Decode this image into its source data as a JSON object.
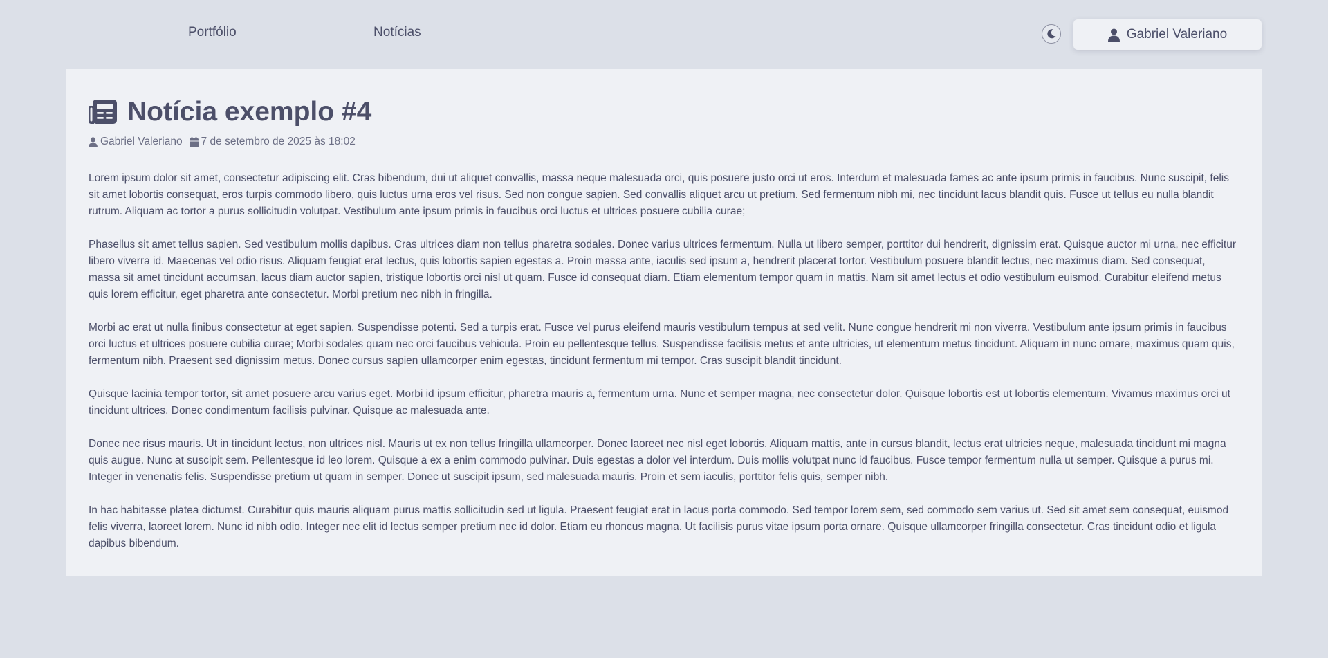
{
  "nav": {
    "portfolio_label": "Portfólio",
    "news_label": "Notícias"
  },
  "header": {
    "theme_toggle_icon": "moon-icon",
    "user_icon": "user-icon",
    "user_name": "Gabriel Valeriano"
  },
  "article": {
    "title_icon": "newspaper-icon",
    "title": "Notícia exemplo #4",
    "author_icon": "user-icon",
    "author": "Gabriel Valeriano",
    "date_icon": "calendar-icon",
    "date": "7 de setembro de 2025 às 18:02",
    "paragraphs": [
      " Lorem ipsum dolor sit amet, consectetur adipiscing elit. Cras bibendum, dui ut aliquet convallis, massa neque malesuada orci, quis posuere justo orci ut eros. Interdum et malesuada fames ac ante ipsum primis in faucibus. Nunc suscipit, felis sit amet lobortis consequat, eros turpis commodo libero, quis luctus urna eros vel risus. Sed non congue sapien. Sed convallis aliquet arcu ut pretium. Sed fermentum nibh mi, nec tincidunt lacus blandit quis. Fusce ut tellus eu nulla blandit rutrum. Aliquam ac tortor a purus sollicitudin volutpat. Vestibulum ante ipsum primis in faucibus orci luctus et ultrices posuere cubilia curae;",
      "Phasellus sit amet tellus sapien. Sed vestibulum mollis dapibus. Cras ultrices diam non tellus pharetra sodales. Donec varius ultrices fermentum. Nulla ut libero semper, porttitor dui hendrerit, dignissim erat. Quisque auctor mi urna, nec efficitur libero viverra id. Maecenas vel odio risus. Aliquam feugiat erat lectus, quis lobortis sapien egestas a. Proin massa ante, iaculis sed ipsum a, hendrerit placerat tortor. Vestibulum posuere blandit lectus, nec maximus diam. Sed consequat, massa sit amet tincidunt accumsan, lacus diam auctor sapien, tristique lobortis orci nisl ut quam. Fusce id consequat diam. Etiam elementum tempor quam in mattis. Nam sit amet lectus et odio vestibulum euismod. Curabitur eleifend metus quis lorem efficitur, eget pharetra ante consectetur. Morbi pretium nec nibh in fringilla.",
      "Morbi ac erat ut nulla finibus consectetur at eget sapien. Suspendisse potenti. Sed a turpis erat. Fusce vel purus eleifend mauris vestibulum tempus at sed velit. Nunc congue hendrerit mi non viverra. Vestibulum ante ipsum primis in faucibus orci luctus et ultrices posuere cubilia curae; Morbi sodales quam nec orci faucibus vehicula. Proin eu pellentesque tellus. Suspendisse facilisis metus et ante ultricies, ut elementum metus tincidunt. Aliquam in nunc ornare, maximus quam quis, fermentum nibh. Praesent sed dignissim metus. Donec cursus sapien ullamcorper enim egestas, tincidunt fermentum mi tempor. Cras suscipit blandit tincidunt.",
      "Quisque lacinia tempor tortor, sit amet posuere arcu varius eget. Morbi id ipsum efficitur, pharetra mauris a, fermentum urna. Nunc et semper magna, nec consectetur dolor. Quisque lobortis est ut lobortis elementum. Vivamus maximus orci ut tincidunt ultrices. Donec condimentum facilisis pulvinar. Quisque ac malesuada ante.",
      "Donec nec risus mauris. Ut in tincidunt lectus, non ultrices nisl. Mauris ut ex non tellus fringilla ullamcorper. Donec laoreet nec nisl eget lobortis. Aliquam mattis, ante in cursus blandit, lectus erat ultricies neque, malesuada tincidunt mi magna quis augue. Nunc at suscipit sem. Pellentesque id leo lorem. Quisque a ex a enim commodo pulvinar. Duis egestas a dolor vel interdum. Duis mollis volutpat nunc id faucibus. Fusce tempor fermentum nulla ut semper. Quisque a purus mi. Integer in venenatis felis. Suspendisse pretium ut quam in semper. Donec ut suscipit ipsum, sed malesuada mauris. Proin et sem iaculis, porttitor felis quis, semper nibh.",
      "In hac habitasse platea dictumst. Curabitur quis mauris aliquam purus mattis sollicitudin sed ut ligula. Praesent feugiat erat in lacus porta commodo. Sed tempor lorem sem, sed commodo sem varius ut. Sed sit amet sem consequat, euismod felis viverra, laoreet lorem. Nunc id nibh odio. Integer nec elit id lectus semper pretium nec id dolor. Etiam eu rhoncus magna. Ut facilisis purus vitae ipsum porta ornare. Quisque ullamcorper fringilla consectetur. Cras tincidunt odio et ligula dapibus bibendum."
    ]
  },
  "colors": {
    "background": "#dce0e8",
    "card": "#eff1f5",
    "text": "#4c4f69",
    "muted_text": "#6c6f85"
  }
}
